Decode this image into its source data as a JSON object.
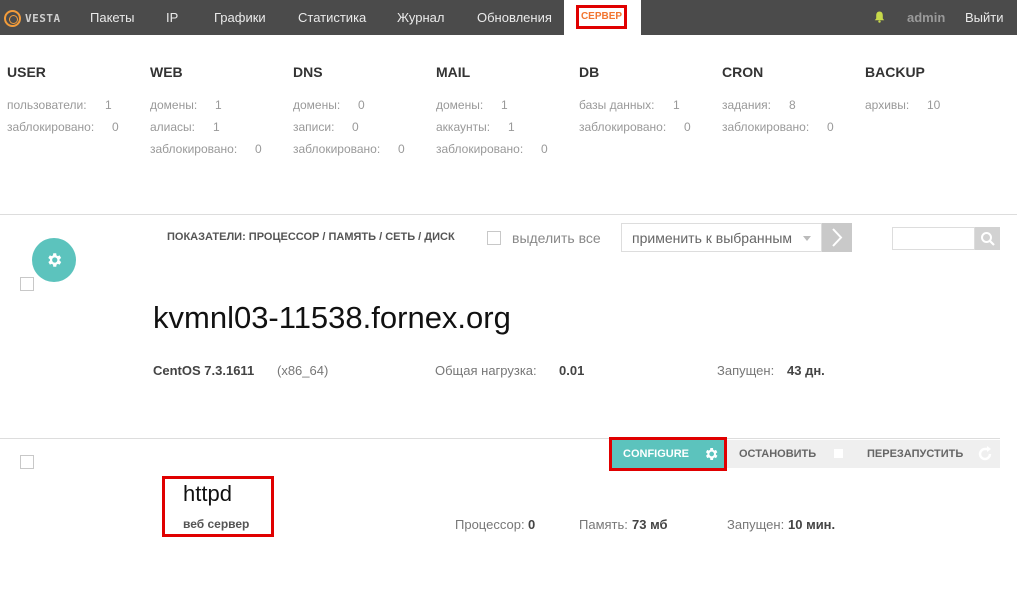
{
  "app": {
    "logo_text": "VESTA"
  },
  "nav": {
    "items": [
      "Пакеты",
      "IP",
      "Графики",
      "Статистика",
      "Журнал",
      "Обновления"
    ],
    "active": "СЕРВЕР",
    "user": "admin",
    "logout": "Выйти"
  },
  "stats": [
    {
      "title": "USER",
      "rows": [
        {
          "label": "пользователи:",
          "value": "1"
        },
        {
          "label": "заблокировано:",
          "value": "0"
        }
      ]
    },
    {
      "title": "WEB",
      "rows": [
        {
          "label": "домены:",
          "value": "1"
        },
        {
          "label": "алиасы:",
          "value": "1"
        },
        {
          "label": "заблокировано:",
          "value": "0"
        }
      ]
    },
    {
      "title": "DNS",
      "rows": [
        {
          "label": "домены:",
          "value": "0"
        },
        {
          "label": "записи:",
          "value": "0"
        },
        {
          "label": "заблокировано:",
          "value": "0"
        }
      ]
    },
    {
      "title": "MAIL",
      "rows": [
        {
          "label": "домены:",
          "value": "1"
        },
        {
          "label": "аккаунты:",
          "value": "1"
        },
        {
          "label": "заблокировано:",
          "value": "0"
        }
      ]
    },
    {
      "title": "DB",
      "rows": [
        {
          "label": "базы данных:",
          "value": "1"
        },
        {
          "label": "заблокировано:",
          "value": "0"
        }
      ]
    },
    {
      "title": "CRON",
      "rows": [
        {
          "label": "задания:",
          "value": "8"
        },
        {
          "label": "заблокировано:",
          "value": "0"
        }
      ]
    },
    {
      "title": "BACKUP",
      "rows": [
        {
          "label": "архивы:",
          "value": "10"
        }
      ]
    }
  ],
  "toolbar": {
    "indicators": "ПОКАЗАТЕЛИ: ПРОЦЕССОР / ПАМЯТЬ / СЕТЬ / ДИСК",
    "select_all": "выделить все",
    "apply_placeholder": "применить к выбранным"
  },
  "server": {
    "hostname": "kvmnl03-11538.fornex.org",
    "os": "CentOS 7.3.1611",
    "arch": "(x86_64)",
    "load_label": "Общая нагрузка:",
    "load_value": "0.01",
    "uptime_label": "Запущен:",
    "uptime_value": "43 дн."
  },
  "service": {
    "configure_label": "CONFIGURE",
    "stop_label": "ОСТАНОВИТЬ",
    "restart_label": "ПЕРЕЗАПУСТИТЬ",
    "name": "httpd",
    "description": "веб сервер",
    "cpu_label": "Процессор:",
    "cpu_value": "0",
    "memory_label": "Память:",
    "memory_value": "73 мб",
    "uptime_label": "Запущен:",
    "uptime_value": "10 мин."
  },
  "colors": {
    "topbar": "#4b4b4b",
    "accent": "#5cc3bd",
    "active_nav": "#f2752f",
    "highlight": "#e00000"
  }
}
